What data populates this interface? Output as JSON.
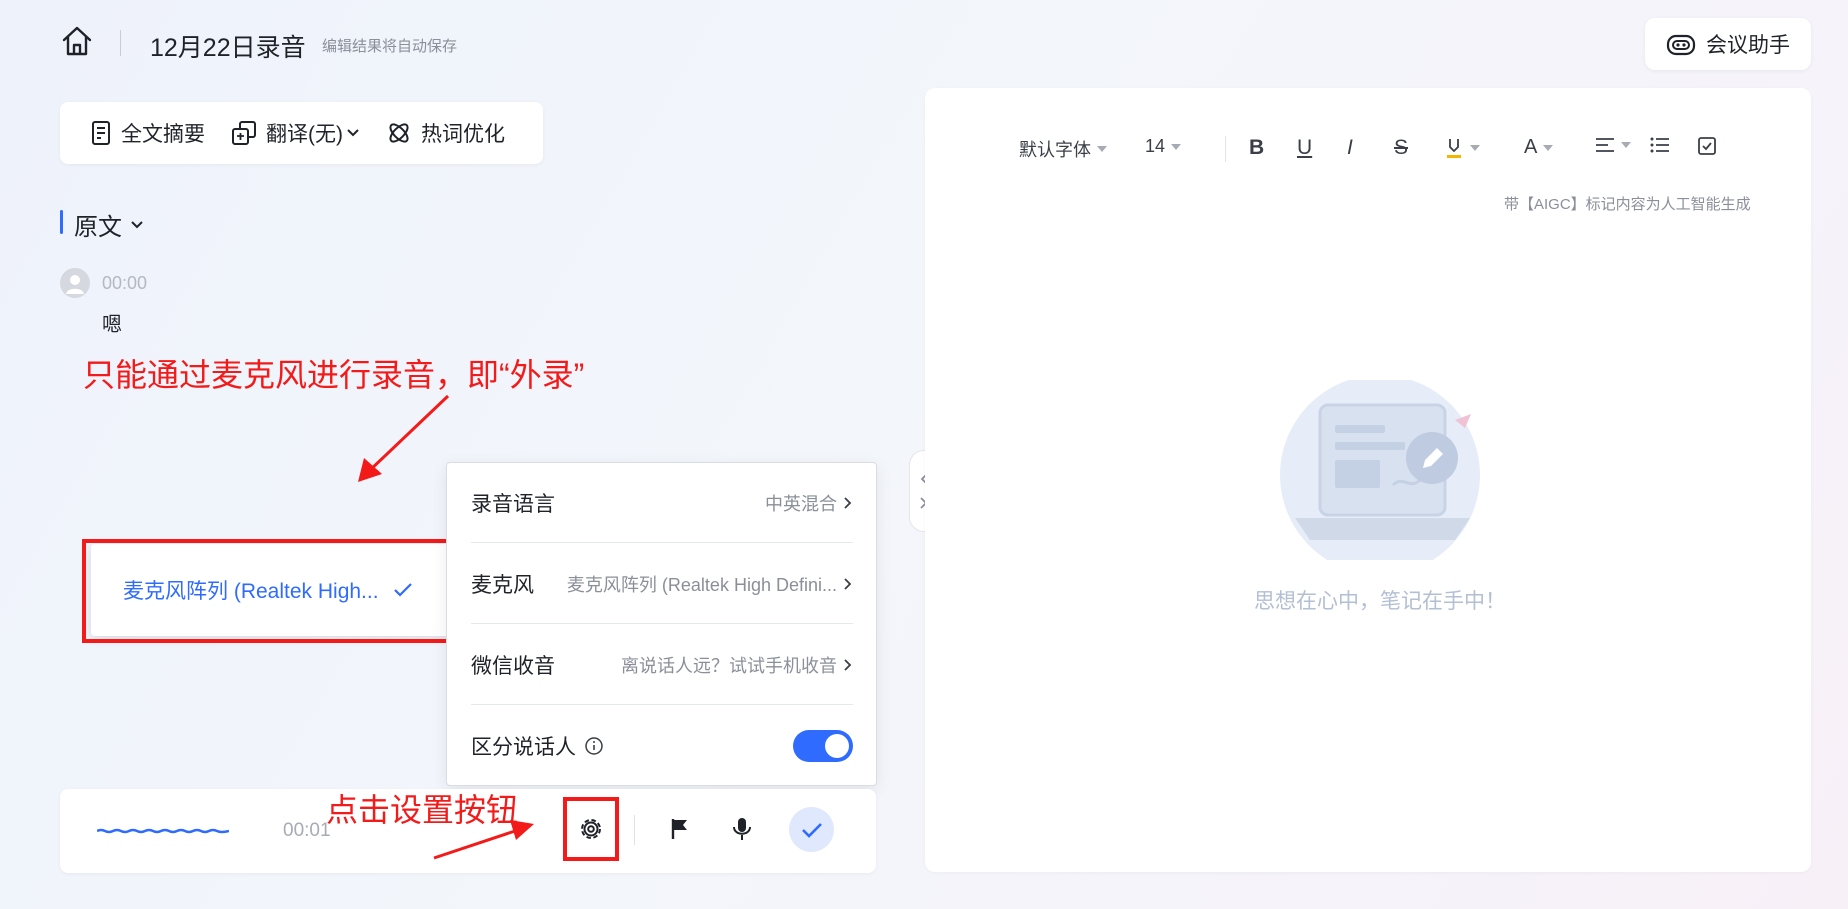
{
  "header": {
    "title": "12月22日录音",
    "autosave_note": "编辑结果将自动保存",
    "assistant_label": "会议助手"
  },
  "toolbar": {
    "summary_label": "全文摘要",
    "translate_label": "翻译(无)",
    "hotword_label": "热词优化"
  },
  "section": {
    "title": "原文"
  },
  "transcript": [
    {
      "time": "00:00",
      "text": "嗯"
    }
  ],
  "annotations": {
    "top": "只能通过麦克风进行录音，即“外录”",
    "bottom": "点击设置按钮"
  },
  "mic_dropdown": {
    "selected": "麦克风阵列 (Realtek High..."
  },
  "settings": {
    "rows": [
      {
        "label": "录音语言",
        "value": "中英混合"
      },
      {
        "label": "麦克风",
        "value": "麦克风阵列 (Realtek High Defini..."
      },
      {
        "label": "微信收音",
        "value": "离说话人远？试试手机收音"
      },
      {
        "label": "区分说话人",
        "toggle_on": true
      }
    ]
  },
  "recorder": {
    "elapsed": "00:01"
  },
  "editor": {
    "font_family": "默认字体",
    "font_size": "14",
    "bold": "B",
    "underline": "U",
    "italic": "I",
    "strike": "S",
    "font_color": "A",
    "aigc_note": "带【AIGC】标记内容为人工智能生成",
    "empty_message": "思想在心中，笔记在手中！"
  },
  "colors": {
    "accent": "#2f6bff",
    "annotation": "#f31a1a"
  }
}
